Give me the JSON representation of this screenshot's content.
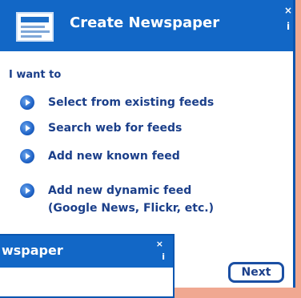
{
  "window": {
    "title": "Create Newspaper",
    "close_glyph": "×",
    "info_glyph": "i"
  },
  "prompt": {
    "heading": "I want to"
  },
  "options": [
    {
      "icon": "arrow-right-icon",
      "line1": "Select from existing feeds",
      "line2": ""
    },
    {
      "icon": "arrow-right-icon",
      "line1": "Search web for feeds",
      "line2": ""
    },
    {
      "icon": "arrow-right-icon",
      "line1": "Add new known feed",
      "line2": ""
    },
    {
      "icon": "arrow-right-icon",
      "line1": "Add new dynamic feed",
      "line2": "(Google News, Flickr, etc.)"
    }
  ],
  "background_window": {
    "title": "wspaper",
    "close_glyph": "×",
    "info_glyph": "i"
  },
  "footer": {
    "next_label": "Next"
  },
  "colors": {
    "titlebar": "#1267c6",
    "accent_text": "#1b3f8a",
    "page_background": "#f0a891"
  }
}
